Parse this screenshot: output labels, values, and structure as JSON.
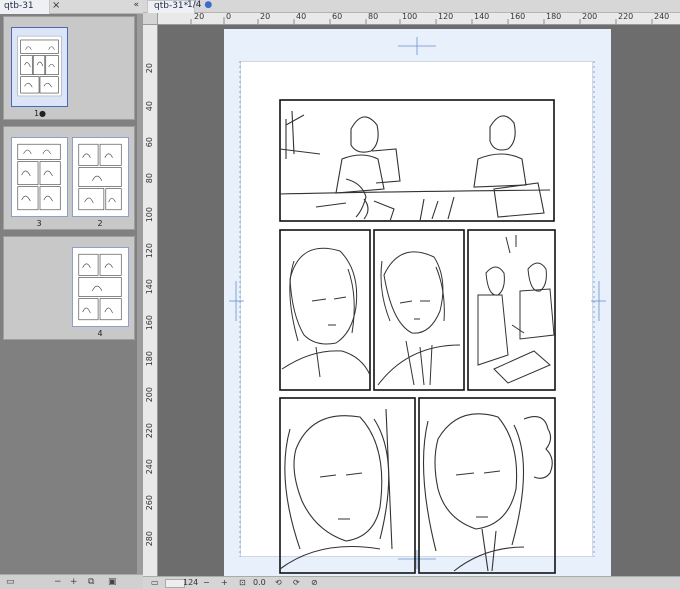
{
  "left_panel": {
    "tab_label": "qtb-31",
    "close_glyph": "×",
    "collapse_glyph": "«",
    "pages": [
      {
        "label": "1●",
        "selected": true
      },
      {
        "label": "3",
        "selected": false
      },
      {
        "label": "2",
        "selected": false
      },
      {
        "label": "4",
        "selected": false
      }
    ]
  },
  "document": {
    "tab_label": "qtb-31*",
    "page_info": "1/4",
    "page_info_dot": "●"
  },
  "rulers": {
    "top_labels": [
      "20",
      "0",
      "20",
      "40",
      "60",
      "80",
      "100",
      "120",
      "140",
      "160",
      "180",
      "200",
      "220",
      "240"
    ],
    "left_labels": [
      "20",
      "40",
      "60",
      "80",
      "100",
      "120",
      "140",
      "160",
      "180",
      "200",
      "220",
      "240",
      "260",
      "280"
    ]
  },
  "status_bar": {
    "zoom_value": "124",
    "angle_value": "0.0"
  },
  "colors": {
    "panel_gray": "#808080",
    "canvas_bg": "#6d6d6d",
    "paper_bleed": "#e8f1fb",
    "selection_blue": "#4a6ab8"
  }
}
